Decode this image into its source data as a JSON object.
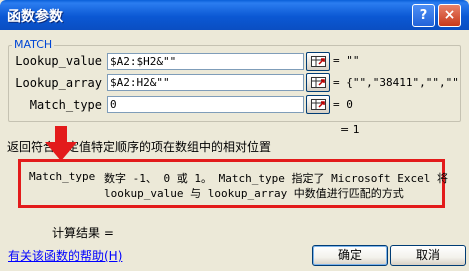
{
  "window": {
    "title": "函数参数",
    "help_glyph": "?",
    "close_glyph": "×"
  },
  "group": {
    "legend": "MATCH"
  },
  "arguments": [
    {
      "label": "Lookup_value",
      "input": "$A2:$H2&\"\"",
      "result": "= \"\""
    },
    {
      "label": "Lookup_array",
      "input": "$A2:H2&\"\"",
      "result": "= {\"\",\"38411\",\"\",\"\""
    },
    {
      "label": "Match_type",
      "input": "0",
      "result": "= 0"
    }
  ],
  "formula_result": "= 1",
  "description": "返回符合特定值特定顺序的项在数组中的相对位置",
  "detail": {
    "arg_name": "Match_type",
    "line1": "数字 -1、 0 或 1。 Match_type 指定了 Microsoft Excel 将",
    "line2": "lookup_value 与 lookup_array 中数值进行匹配的方式"
  },
  "calc_result_label": "计算结果 =",
  "help_link": "有关该函数的帮助(H)",
  "buttons": {
    "ok": "确定",
    "cancel": "取消"
  },
  "colors": {
    "titlebar": "#0a5fd8",
    "highlight_red": "#e31b1b",
    "link_blue": "#0000ff",
    "dialog_bg": "#ece9d8"
  }
}
